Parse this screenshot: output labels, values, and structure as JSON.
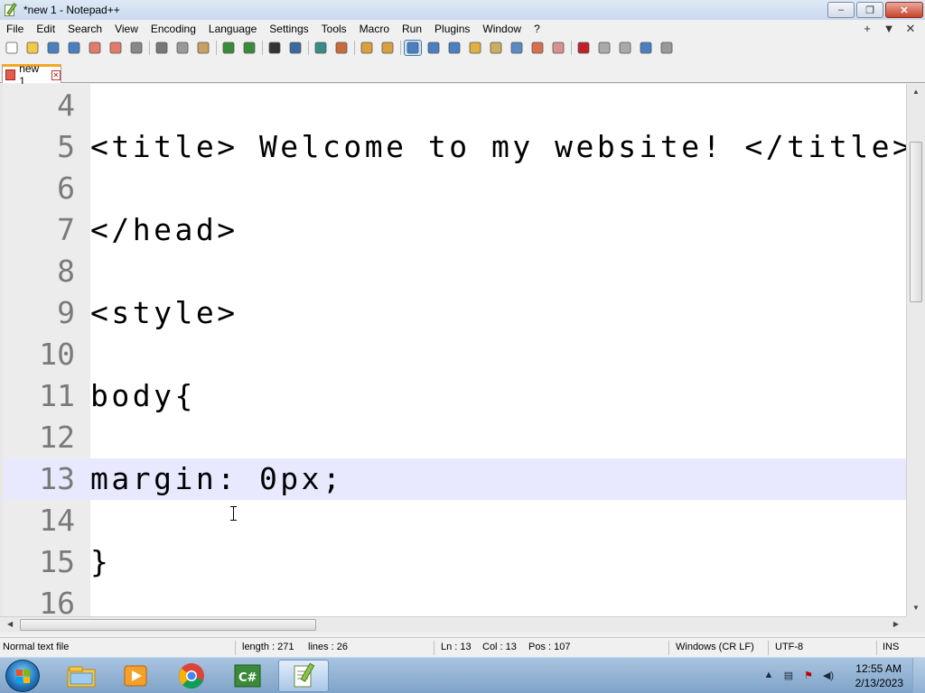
{
  "window": {
    "title": "*new 1 - Notepad++",
    "min": "–",
    "max": "❐",
    "close": "✕"
  },
  "menu": {
    "items": [
      "File",
      "Edit",
      "Search",
      "View",
      "Encoding",
      "Language",
      "Settings",
      "Tools",
      "Macro",
      "Run",
      "Plugins",
      "Window",
      "?"
    ],
    "right": [
      "+",
      "▼",
      "✕"
    ]
  },
  "toolbar": {
    "icons": [
      "new-file-icon",
      "open-file-icon",
      "save-icon",
      "save-all-icon",
      "close-icon",
      "close-all-icon",
      "print-icon",
      "sep",
      "cut-icon",
      "copy-icon",
      "paste-icon",
      "sep",
      "undo-icon",
      "redo-icon",
      "sep",
      "find-icon",
      "replace-icon",
      "sep",
      "zoom-in-icon",
      "zoom-out-icon",
      "sep",
      "sync-vertical-icon",
      "sync-horizontal-icon",
      "sep",
      "word-wrap-icon",
      "show-all-chars-icon",
      "indent-guide-icon",
      "user-lang-icon",
      "doc-map-icon",
      "function-list-icon",
      "folder-workspace-icon",
      "monitoring-icon",
      "sep",
      "record-macro-icon",
      "stop-macro-icon",
      "play-macro-icon",
      "run-macro-multiple-icon",
      "save-macro-icon"
    ]
  },
  "tab": {
    "label": "new 1"
  },
  "editor": {
    "lines": [
      {
        "num": "4",
        "text": ""
      },
      {
        "num": "5",
        "text": "<title> Welcome to my website! </title>"
      },
      {
        "num": "6",
        "text": ""
      },
      {
        "num": "7",
        "text": "</head>"
      },
      {
        "num": "8",
        "text": ""
      },
      {
        "num": "9",
        "text": "<style>"
      },
      {
        "num": "10",
        "text": ""
      },
      {
        "num": "11",
        "text": "body{"
      },
      {
        "num": "12",
        "text": ""
      },
      {
        "num": "13",
        "text": "margin: 0px;"
      },
      {
        "num": "14",
        "text": ""
      },
      {
        "num": "15",
        "text": "}"
      },
      {
        "num": "16",
        "text": ""
      }
    ],
    "current_line": "13"
  },
  "status": {
    "file_type": "Normal text file",
    "length": "length : 271",
    "lines": "lines : 26",
    "ln": "Ln : 13",
    "col": "Col : 13",
    "pos": "Pos : 107",
    "eol": "Windows (CR LF)",
    "encoding": "UTF-8",
    "mode": "INS"
  },
  "taskbar": {
    "apps": [
      "explorer-icon",
      "media-player-icon",
      "chrome-icon",
      "csharp-icon",
      "notepadpp-icon"
    ],
    "time": "12:55 AM",
    "date": "2/13/2023"
  }
}
